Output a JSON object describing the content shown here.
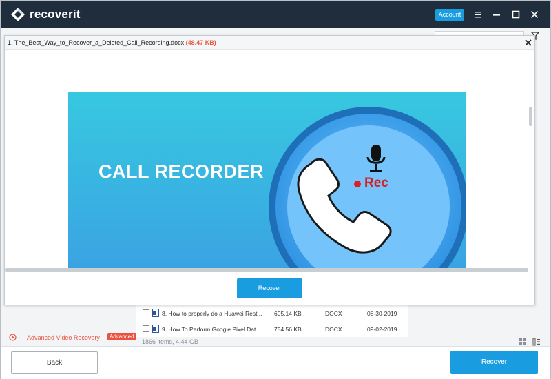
{
  "app": {
    "brand": "recoverit",
    "account_label": "Account"
  },
  "preview": {
    "file_name": "1. The_Best_Way_to_Recover_a_Deleted_Call_Recording.docx",
    "file_size": "(48.47 KB)",
    "image_heading": "CALL RECORDER",
    "image_rec_label": "Rec",
    "recover_label": "Recover"
  },
  "file_list": {
    "rows": [
      {
        "name": "8. How to properly do a Huawei Rest...",
        "size": "605.14  KB",
        "type": "DOCX",
        "date": "08-30-2019"
      },
      {
        "name": "9. How To Perform Google Pixel Dat...",
        "size": "754.56  KB",
        "type": "DOCX",
        "date": "09-02-2019"
      }
    ]
  },
  "sidebar": {
    "advanced_video_recovery": "Advanced Video Recovery",
    "advanced_badge": "Advanced"
  },
  "status": {
    "summary": "1866 items, 4.44  GB"
  },
  "footer": {
    "back_label": "Back",
    "recover_label": "Recover"
  },
  "colors": {
    "titlebar": "#1f2d3d",
    "accent": "#1a9de0",
    "size_highlight": "#e9533f"
  }
}
